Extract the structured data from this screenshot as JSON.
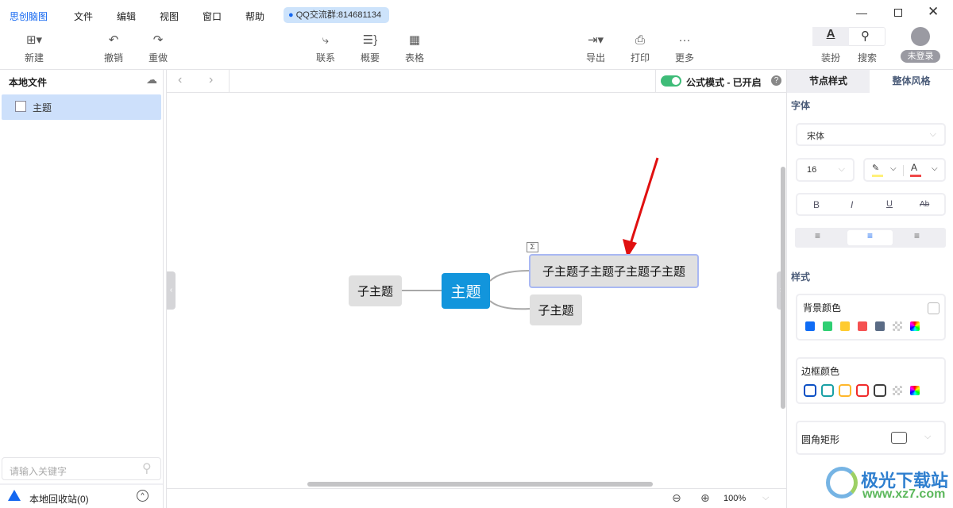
{
  "app": {
    "name": "思创脑图",
    "menus": [
      "文件",
      "编辑",
      "视图",
      "窗口",
      "帮助"
    ],
    "qq_badge": "QQ交流群:814681134"
  },
  "toolbar": {
    "new": "新建",
    "undo": "撤销",
    "redo": "重做",
    "relation": "联系",
    "summary": "概要",
    "table": "表格",
    "export": "导出",
    "print": "打印",
    "more": "更多",
    "style": "装扮",
    "search": "搜索",
    "login": "未登录"
  },
  "sidebar": {
    "title": "本地文件",
    "files": [
      {
        "name": "主题"
      }
    ],
    "search_placeholder": "请输入关键字",
    "recycle": "本地回收站(0)"
  },
  "canvas": {
    "formula_mode": "公式模式 - 已开启",
    "formula_on": true,
    "zoom": "100%",
    "nodes": {
      "root": "主题",
      "left": "子主题",
      "right1": "子主题子主题子主题子主题",
      "right2": "子主题"
    }
  },
  "panel": {
    "tabs": [
      "节点样式",
      "整体风格"
    ],
    "active_tab": 0,
    "font_label": "字体",
    "font": "宋体",
    "size": "16",
    "highlight_color": "#fff17a",
    "text_color": "#f04848",
    "format": [
      "B",
      "I",
      "U",
      "Ab"
    ],
    "align_active": "center",
    "style_label": "样式",
    "bg_label": "背景颜色",
    "bg_colors": [
      "#0f6cf5",
      "#2fcf73",
      "#ffcb2f",
      "#f55151",
      "#5a6b85"
    ],
    "border_label": "边框颜色",
    "border_colors": [
      "#0a4fc4",
      "#19a0a5",
      "#ffb72a",
      "#f02b2b",
      "#3d3d3d"
    ],
    "shape": "圆角矩形"
  },
  "watermark": {
    "text": "极光下载站",
    "url": "www.xz7.com"
  }
}
